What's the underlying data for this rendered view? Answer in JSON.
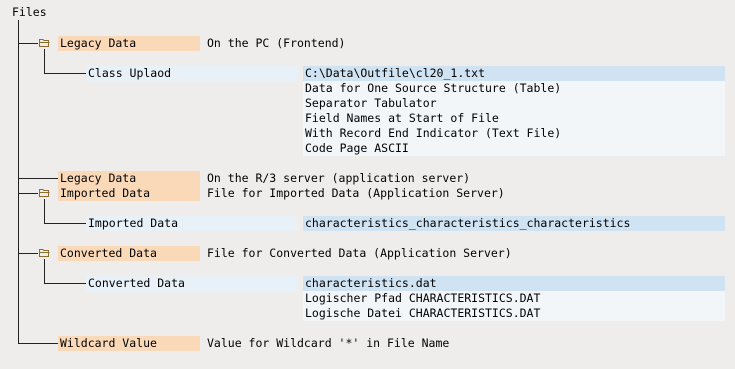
{
  "tree": {
    "root": "Files",
    "nodes": {
      "legacy_pc": {
        "label": "Legacy Data",
        "desc": "On the PC (Frontend)"
      },
      "class_upload": {
        "label": "Class Uplaod",
        "values": [
          "C:\\Data\\Outfile\\cl20_1.txt",
          "Data for One Source Structure (Table)",
          "Separator Tabulator",
          "Field Names at Start of File",
          "With Record End Indicator (Text File)",
          "Code Page ASCII"
        ]
      },
      "legacy_r3": {
        "label": "Legacy Data",
        "desc": "On the R/3 server (application server)"
      },
      "imported": {
        "label": "Imported Data",
        "desc": "File for Imported Data (Application Server)"
      },
      "imported_child": {
        "label": "Imported Data",
        "values": [
          "characteristics_characteristics_characteristics"
        ]
      },
      "converted": {
        "label": "Converted Data",
        "desc": "File for Converted Data (Application Server)"
      },
      "converted_child": {
        "label": "Converted Data",
        "values": [
          "characteristics.dat",
          "Logischer Pfad CHARACTERISTICS.DAT",
          "Logische Datei CHARACTERISTICS.DAT"
        ]
      },
      "wildcard": {
        "label": "Wildcard Value",
        "desc": "Value for Wildcard '*' in File Name"
      }
    }
  },
  "colors": {
    "header_bg": "#fad9b9",
    "selected_value_bg": "#cfe3f3",
    "value_bg": "#f2f6f9",
    "background": "#eeedeb"
  },
  "icons": {
    "folder": "folder-open-icon"
  }
}
